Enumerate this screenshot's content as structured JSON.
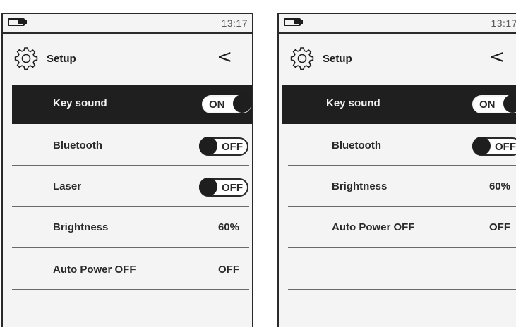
{
  "screens": [
    {
      "status": {
        "time": "13:17"
      },
      "header": {
        "title": "Setup",
        "back_glyph": "<"
      },
      "rows": [
        {
          "label": "Key sound",
          "toggle": "ON"
        },
        {
          "label": "Bluetooth",
          "toggle": "OFF"
        },
        {
          "label": "Laser",
          "toggle": "OFF"
        },
        {
          "label": "Brightness",
          "value": "60%"
        },
        {
          "label": "Auto Power OFF",
          "value": "OFF"
        }
      ]
    },
    {
      "status": {
        "time": "13:17"
      },
      "header": {
        "title": "Setup",
        "back_glyph": "<"
      },
      "rows": [
        {
          "label": "Key sound",
          "toggle": "ON"
        },
        {
          "label": "Bluetooth",
          "toggle": "OFF"
        },
        {
          "label": "Brightness",
          "value": "60%"
        },
        {
          "label": "Auto Power OFF",
          "value": "OFF"
        }
      ]
    }
  ],
  "icons": {
    "battery": "battery-icon",
    "settings": "gear-icon",
    "back": "chevron-left-icon"
  },
  "colors": {
    "selected_row": "#1f1f1f",
    "screen_bg": "#f4f4f4",
    "text": "#1e1e1e"
  }
}
